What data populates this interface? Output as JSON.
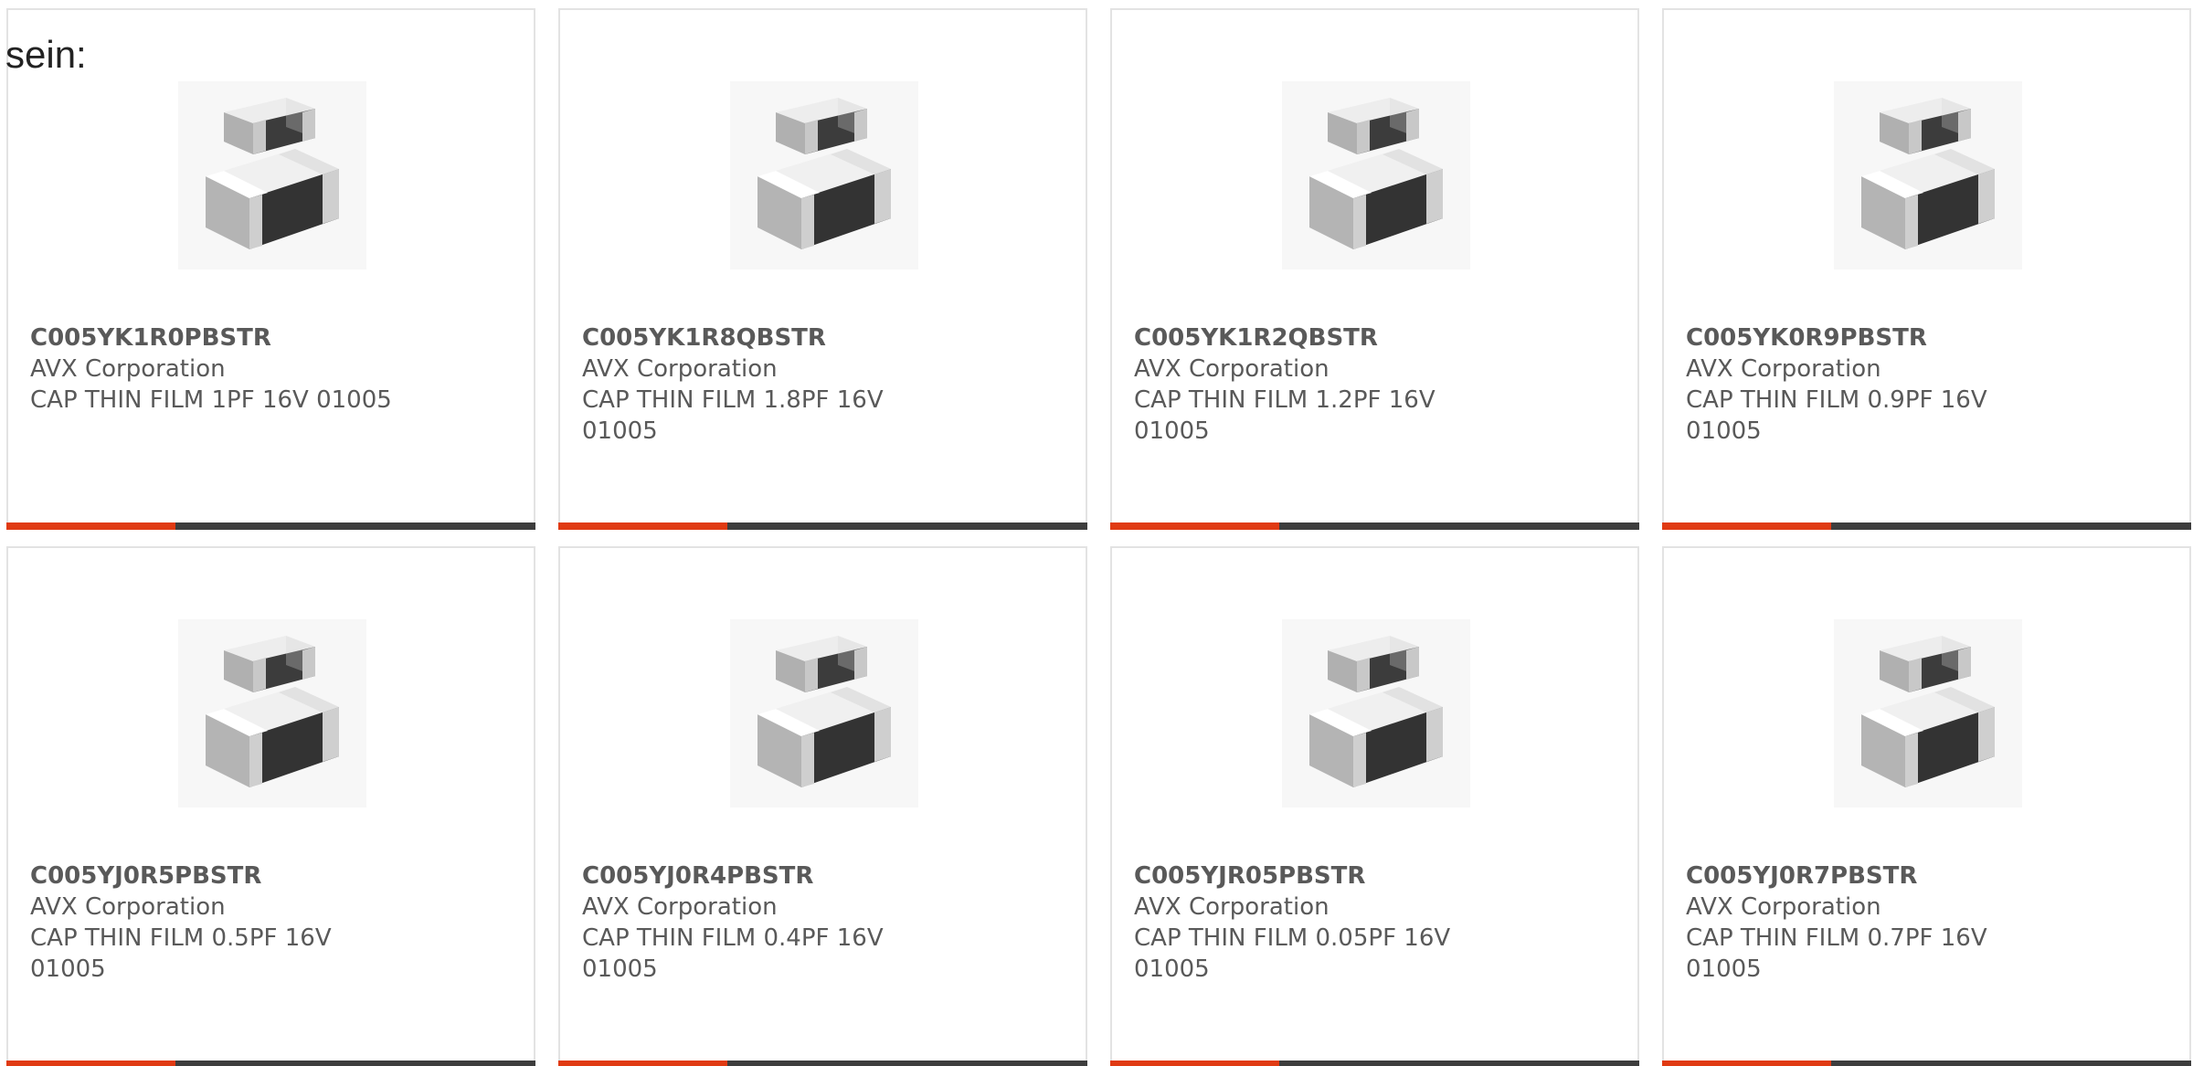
{
  "intro_text": "sein:",
  "colors": {
    "accent": "#e03a12",
    "bar_dark": "#3d3d3d",
    "text": "#595959",
    "border": "#e3e3e3"
  },
  "progress_fraction": 0.32,
  "products": [
    {
      "part": "C005YK1R0PBSTR",
      "manufacturer": "AVX Corporation",
      "description": "CAP THIN FILM 1PF 16V 01005",
      "image_icon": "smd-capacitor-icon"
    },
    {
      "part": "C005YK1R8QBSTR",
      "manufacturer": "AVX Corporation",
      "description": "CAP THIN FILM 1.8PF 16V 01005",
      "image_icon": "smd-capacitor-icon"
    },
    {
      "part": "C005YK1R2QBSTR",
      "manufacturer": "AVX Corporation",
      "description": "CAP THIN FILM 1.2PF 16V 01005",
      "image_icon": "smd-capacitor-icon"
    },
    {
      "part": "C005YK0R9PBSTR",
      "manufacturer": "AVX Corporation",
      "description": "CAP THIN FILM 0.9PF 16V 01005",
      "image_icon": "smd-capacitor-icon"
    },
    {
      "part": "C005YJ0R5PBSTR",
      "manufacturer": "AVX Corporation",
      "description": "CAP THIN FILM 0.5PF 16V 01005",
      "image_icon": "smd-capacitor-icon"
    },
    {
      "part": "C005YJ0R4PBSTR",
      "manufacturer": "AVX Corporation",
      "description": "CAP THIN FILM 0.4PF 16V 01005",
      "image_icon": "smd-capacitor-icon"
    },
    {
      "part": "C005YJR05PBSTR",
      "manufacturer": "AVX Corporation",
      "description": "CAP THIN FILM 0.05PF 16V 01005",
      "image_icon": "smd-capacitor-icon"
    },
    {
      "part": "C005YJ0R7PBSTR",
      "manufacturer": "AVX Corporation",
      "description": "CAP THIN FILM 0.7PF 16V 01005",
      "image_icon": "smd-capacitor-icon"
    }
  ]
}
